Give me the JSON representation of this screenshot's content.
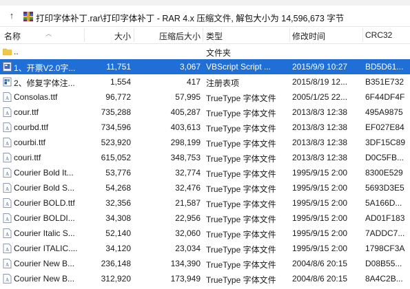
{
  "path_bar": {
    "path": "打印字体补丁.rar\\打印字体补丁 - RAR 4.x 压缩文件, 解包大小为 14,596,673 字节"
  },
  "columns": {
    "name": "名称",
    "size": "大小",
    "packed": "压缩后大小",
    "type": "类型",
    "modified": "修改时间",
    "crc": "CRC32"
  },
  "files": [
    {
      "name": "..",
      "size": "",
      "packed": "",
      "type": "文件夹",
      "modified": "",
      "crc": "",
      "icon": "folder-icon"
    },
    {
      "name": "1、开票V2.0字...",
      "size": "11,751",
      "packed": "3,067",
      "type": "VBScript Script ...",
      "modified": "2015/9/9 10:27",
      "crc": "BD5D61...",
      "icon": "vbscript-file-icon"
    },
    {
      "name": "2、修复字体注...",
      "size": "1,554",
      "packed": "417",
      "type": "注册表项",
      "modified": "2015/8/19 12...",
      "crc": "B351E732",
      "icon": "registry-file-icon"
    },
    {
      "name": "Consolas.ttf",
      "size": "96,772",
      "packed": "57,995",
      "type": "TrueType 字体文件",
      "modified": "2005/1/25 22...",
      "crc": "6F44DF4F",
      "icon": "font-file-icon"
    },
    {
      "name": "cour.ttf",
      "size": "735,288",
      "packed": "405,287",
      "type": "TrueType 字体文件",
      "modified": "2013/8/3 12:38",
      "crc": "495A9875",
      "icon": "font-file-icon"
    },
    {
      "name": "courbd.ttf",
      "size": "734,596",
      "packed": "403,613",
      "type": "TrueType 字体文件",
      "modified": "2013/8/3 12:38",
      "crc": "EF027E84",
      "icon": "font-file-icon"
    },
    {
      "name": "courbi.ttf",
      "size": "523,920",
      "packed": "298,199",
      "type": "TrueType 字体文件",
      "modified": "2013/8/3 12:38",
      "crc": "3DF15C89",
      "icon": "font-file-icon"
    },
    {
      "name": "couri.ttf",
      "size": "615,052",
      "packed": "348,753",
      "type": "TrueType 字体文件",
      "modified": "2013/8/3 12:38",
      "crc": "D0C5FB...",
      "icon": "font-file-icon"
    },
    {
      "name": "Courier Bold It...",
      "size": "53,776",
      "packed": "32,774",
      "type": "TrueType 字体文件",
      "modified": "1995/9/15 2:00",
      "crc": "8300E529",
      "icon": "font-file-icon"
    },
    {
      "name": "Courier Bold S...",
      "size": "54,268",
      "packed": "32,476",
      "type": "TrueType 字体文件",
      "modified": "1995/9/15 2:00",
      "crc": "5693D3E5",
      "icon": "font-file-icon"
    },
    {
      "name": "Courier BOLD.ttf",
      "size": "32,356",
      "packed": "21,587",
      "type": "TrueType 字体文件",
      "modified": "1995/9/15 2:00",
      "crc": "5A166D...",
      "icon": "font-file-icon"
    },
    {
      "name": "Courier BOLDI...",
      "size": "34,308",
      "packed": "22,956",
      "type": "TrueType 字体文件",
      "modified": "1995/9/15 2:00",
      "crc": "AD01F183",
      "icon": "font-file-icon"
    },
    {
      "name": "Courier Italic S...",
      "size": "52,140",
      "packed": "32,060",
      "type": "TrueType 字体文件",
      "modified": "1995/9/15 2:00",
      "crc": "7ADDC7...",
      "icon": "font-file-icon"
    },
    {
      "name": "Courier ITALIC....",
      "size": "34,120",
      "packed": "23,034",
      "type": "TrueType 字体文件",
      "modified": "1995/9/15 2:00",
      "crc": "1798CF3A",
      "icon": "font-file-icon"
    },
    {
      "name": "Courier New B...",
      "size": "236,148",
      "packed": "134,390",
      "type": "TrueType 字体文件",
      "modified": "2004/8/6 20:15",
      "crc": "D08B55...",
      "icon": "font-file-icon"
    },
    {
      "name": "Courier New B...",
      "size": "312,920",
      "packed": "173,949",
      "type": "TrueType 字体文件",
      "modified": "2004/8/6 20:15",
      "crc": "8A4C2B...",
      "icon": "font-file-icon"
    }
  ],
  "selected_row": 1,
  "colors": {
    "selection": "#1f6fd6",
    "folder": "#f3c744",
    "font_icon": "#2e63b8"
  }
}
